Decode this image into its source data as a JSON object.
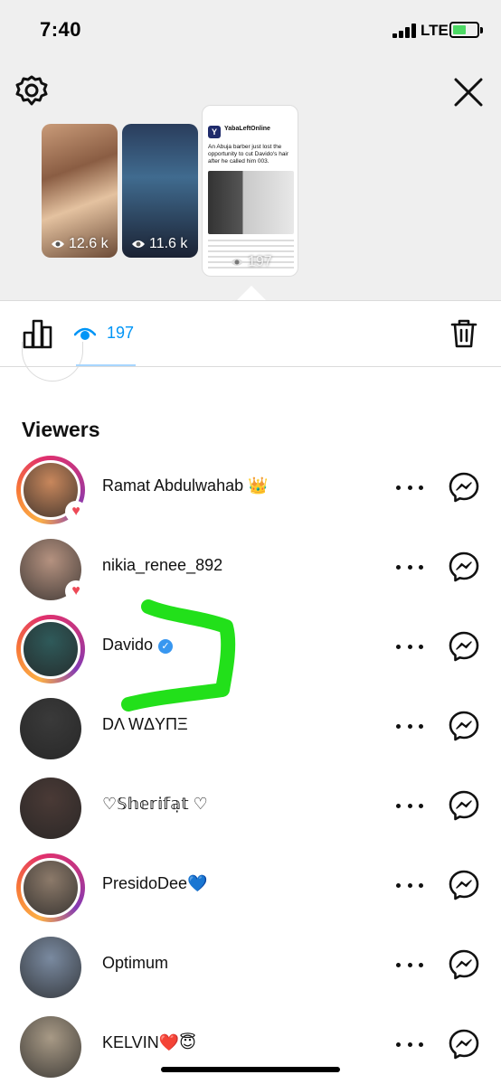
{
  "status_bar": {
    "time": "7:40",
    "network": "LTE",
    "icons": [
      "signal-bars-icon",
      "battery-charging-icon"
    ]
  },
  "header": {
    "icons": [
      "gear-icon",
      "close-icon"
    ]
  },
  "stories": [
    {
      "views": "12.6 k",
      "selected": false
    },
    {
      "views": "11.6 k",
      "selected": false
    },
    {
      "views": "197",
      "selected": true,
      "post_account": "YabaLeftOnline",
      "post_text": "An Abuja barber just lost the opportunity to cut Davido's hair after he called him 003."
    }
  ],
  "stats": {
    "view_count": "197",
    "icons": [
      "bar-chart-icon",
      "eye-icon",
      "trash-icon"
    ]
  },
  "viewers_heading": "Viewers",
  "viewers": [
    {
      "name": "Ramat Abdulwahab 👑",
      "ring": true,
      "liked": true,
      "verified": false,
      "color": "#c8875c"
    },
    {
      "name": "nikia_renee_892",
      "ring": false,
      "liked": true,
      "verified": false,
      "color": "#b59280"
    },
    {
      "name": "Davido",
      "ring": true,
      "liked": false,
      "verified": true,
      "color": "#2f5a5a"
    },
    {
      "name": "DΛ WΔYПΞ",
      "ring": false,
      "liked": false,
      "verified": false,
      "color": "#3a3a3a"
    },
    {
      "name": "♡𝕊𝕙𝕖𝕣𝕚𝕗𝕒̣𝕥 ♡",
      "ring": false,
      "liked": false,
      "verified": false,
      "color": "#4a3a36"
    },
    {
      "name": "PresidoDee💙",
      "ring": true,
      "liked": false,
      "verified": false,
      "color": "#8c7a6a"
    },
    {
      "name": "Optimum",
      "ring": false,
      "liked": false,
      "verified": false,
      "color": "#7a8aa0"
    },
    {
      "name": "KELVIN❤️😇",
      "ring": false,
      "liked": false,
      "verified": false,
      "color": "#a89a86"
    }
  ],
  "colors": {
    "accent_blue": "#0095f6",
    "heart_red": "#ed4956",
    "highlight_green": "#22e01a",
    "verified_blue": "#3897f0"
  }
}
